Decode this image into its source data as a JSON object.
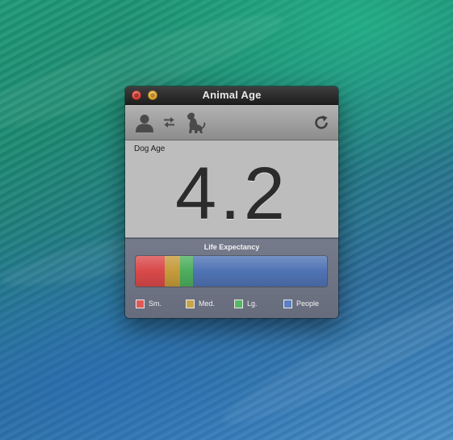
{
  "window": {
    "title": "Animal Age"
  },
  "toolbar": {
    "icons": [
      "person-icon",
      "swap-arrows-icon",
      "dog-icon",
      "refresh-icon"
    ]
  },
  "result": {
    "label": "Dog Age",
    "value": "4.2"
  },
  "life_expectancy": {
    "title": "Life Expectancy",
    "segments": [
      {
        "name": "Sm.",
        "color": "#d9494a",
        "fraction": 0.15
      },
      {
        "name": "Med.",
        "color": "#c59b3a",
        "fraction": 0.08
      },
      {
        "name": "Lg.",
        "color": "#4cae5e",
        "fraction": 0.07
      },
      {
        "name": "People",
        "color": "#4f73b4",
        "fraction": 0.7
      }
    ],
    "legend": {
      "small": "Sm.",
      "medium": "Med.",
      "large": "Lg.",
      "people": "People"
    }
  }
}
